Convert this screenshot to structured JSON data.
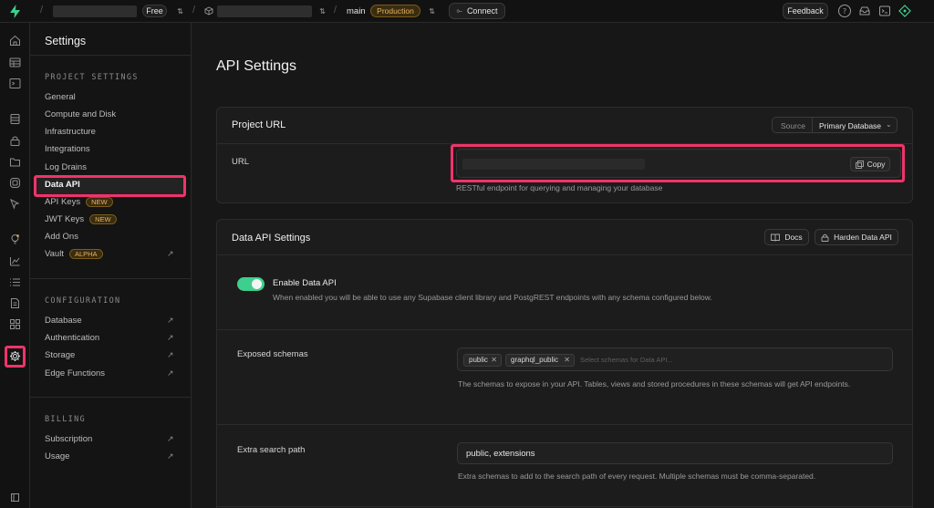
{
  "topbar": {
    "plan_badge": "Free",
    "branch": "main",
    "env_badge": "Production",
    "connect_label": "Connect",
    "feedback_label": "Feedback"
  },
  "sidebar": {
    "title": "Settings",
    "sections": [
      {
        "heading": "PROJECT SETTINGS",
        "items": [
          {
            "label": "General"
          },
          {
            "label": "Compute and Disk"
          },
          {
            "label": "Infrastructure"
          },
          {
            "label": "Integrations"
          },
          {
            "label": "Log Drains"
          },
          {
            "label": "Data API",
            "active": true
          },
          {
            "label": "API Keys",
            "badge": "NEW"
          },
          {
            "label": "JWT Keys",
            "badge": "NEW"
          },
          {
            "label": "Add Ons"
          },
          {
            "label": "Vault",
            "badge": "ALPHA",
            "external": true
          }
        ]
      },
      {
        "heading": "CONFIGURATION",
        "items": [
          {
            "label": "Database",
            "external": true
          },
          {
            "label": "Authentication",
            "external": true
          },
          {
            "label": "Storage",
            "external": true
          },
          {
            "label": "Edge Functions",
            "external": true
          }
        ]
      },
      {
        "heading": "BILLING",
        "items": [
          {
            "label": "Subscription",
            "external": true
          },
          {
            "label": "Usage",
            "external": true
          }
        ]
      }
    ]
  },
  "main": {
    "page_title": "API Settings",
    "project_url": {
      "title": "Project URL",
      "source_label": "Source",
      "source_value": "Primary Database",
      "url_label": "URL",
      "copy_label": "Copy",
      "url_help": "RESTful endpoint for querying and managing your database"
    },
    "data_api": {
      "title": "Data API Settings",
      "docs_label": "Docs",
      "harden_label": "Harden Data API",
      "enable_label": "Enable Data API",
      "enable_desc": "When enabled you will be able to use any Supabase client library and PostgREST endpoints with any schema configured below.",
      "enabled": true,
      "exposed_label": "Exposed schemas",
      "schemas": [
        "public",
        "graphql_public"
      ],
      "schemas_placeholder": "Select schemas for Data API...",
      "exposed_help": "The schemas to expose in your API. Tables, views and stored procedures in these schemas will get API endpoints.",
      "search_path_label": "Extra search path",
      "search_path_value": "public, extensions",
      "search_path_help": "Extra schemas to add to the search path of every request. Multiple schemas must be comma-separated."
    }
  },
  "colors": {
    "brand": "#3ecf8e",
    "highlight": "#f0336a",
    "badge": "#e3b45c"
  }
}
